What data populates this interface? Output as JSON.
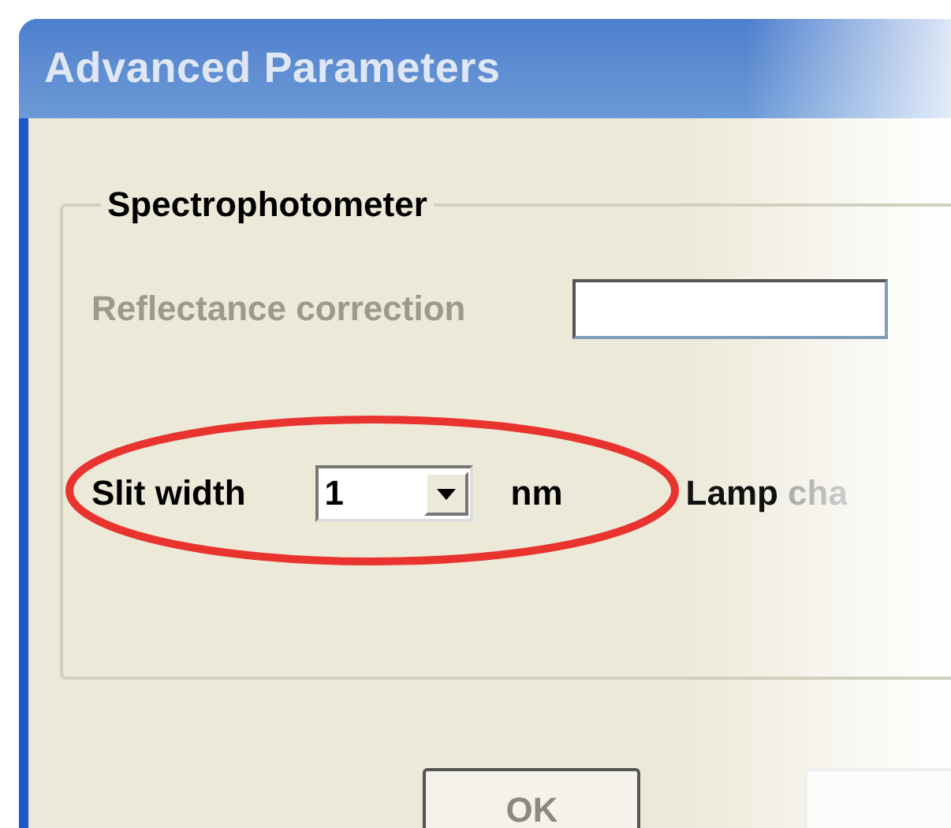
{
  "window": {
    "title": "Advanced Parameters"
  },
  "group": {
    "legend": "Spectrophotometer"
  },
  "reflectance": {
    "label": "Reflectance correction",
    "disabled": true
  },
  "slit_width": {
    "label": "Slit width",
    "value": "1",
    "unit": "nm"
  },
  "lamp": {
    "label": "Lamp cha"
  },
  "buttons": [
    {
      "label": "OK",
      "disabled": true
    }
  ]
}
